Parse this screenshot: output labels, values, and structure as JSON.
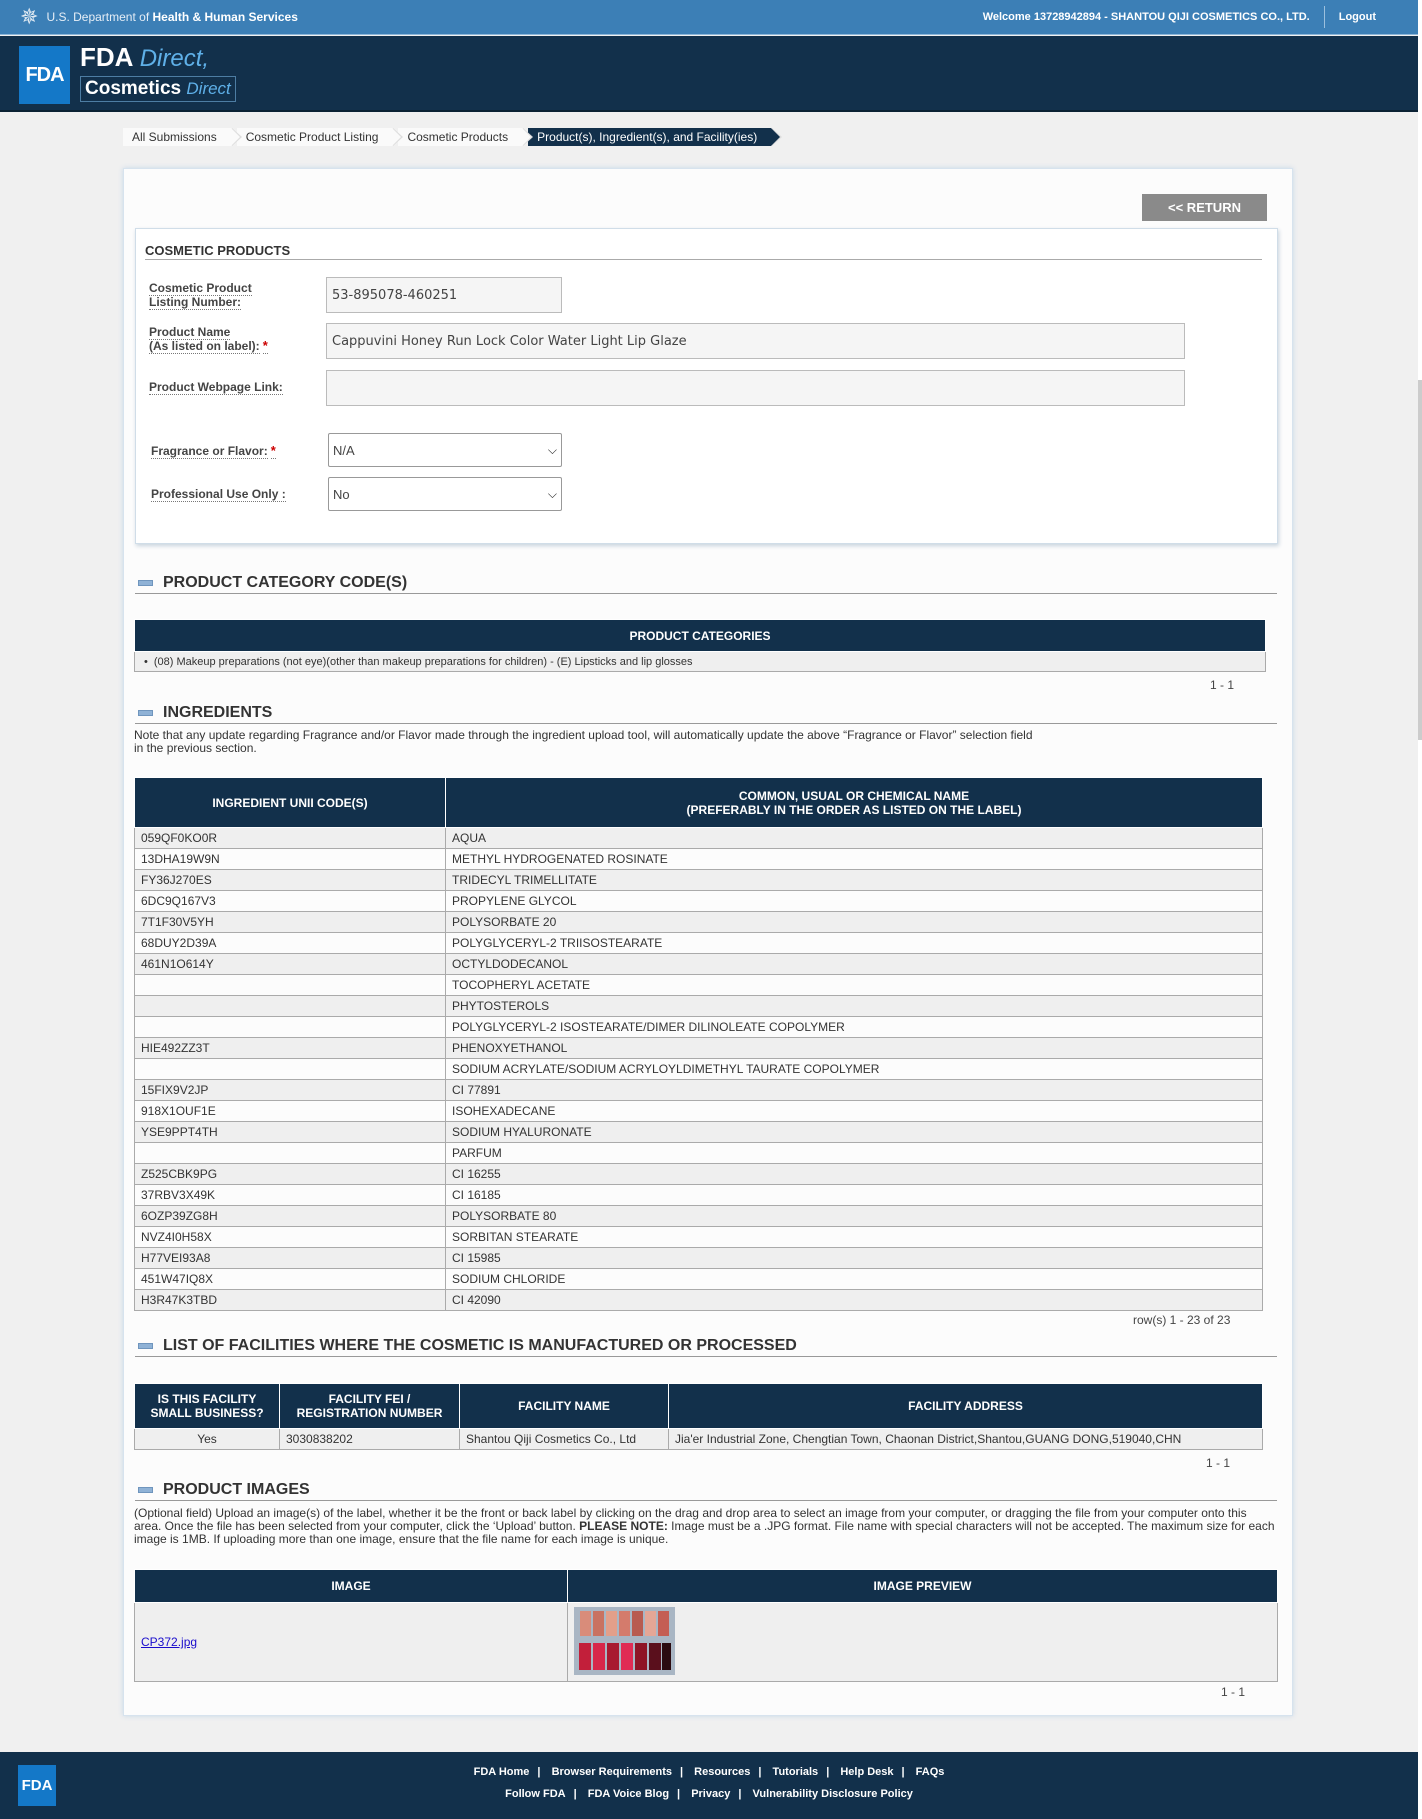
{
  "header": {
    "dept_prefix": "U.S. Department of ",
    "dept_name": "Health & Human Services",
    "welcome": "Welcome 13728942894 - SHANTOU QIJI COSMETICS CO., LTD.",
    "logout": "Logout"
  },
  "banner": {
    "logo": "FDA",
    "line1_bold": "FDA",
    "line1_italic": "Direct",
    "line2_bold": "Cosmetics",
    "line2_italic": "Direct"
  },
  "breadcrumbs": [
    "All Submissions",
    "Cosmetic Product Listing",
    "Cosmetic Products",
    "Product(s), Ingredient(s), and Facility(ies)"
  ],
  "return_button": "<< RETURN",
  "cosmetic_products": {
    "title": "COSMETIC PRODUCTS",
    "listing_label_1": "Cosmetic Product",
    "listing_label_2": "Listing Number:",
    "listing_value": "53-895078-460251",
    "name_label_1": "Product Name",
    "name_label_2": "(As listed on label):",
    "name_value": "Cappuvini Honey Run Lock Color Water Light Lip Glaze",
    "webpage_label": "Product Webpage Link:",
    "webpage_value": "",
    "fragrance_label": "Fragrance or Flavor:",
    "fragrance_value": "N/A",
    "professional_label": "Professional Use Only :",
    "professional_value": "No",
    "required_mark": "*"
  },
  "category_section": {
    "title": "PRODUCT CATEGORY CODE(S)",
    "table_header": "PRODUCT CATEGORIES",
    "items": [
      "(08) Makeup preparations (not eye)(other than makeup preparations for children) - (E) Lipsticks and lip glosses"
    ],
    "pager": "1 - 1"
  },
  "ingredients_section": {
    "title": "INGREDIENTS",
    "note_1": "Note that any update regarding Fragrance and/or Flavor made through the ingredient upload tool, will automatically update the above “Fragrance or Flavor” selection field",
    "note_2": "in the previous section.",
    "col_unii": "INGREDIENT UNII CODE(S)",
    "col_name_1": "COMMON, USUAL OR CHEMICAL NAME",
    "col_name_2": "(PREFERABLY IN THE ORDER AS LISTED ON THE LABEL)",
    "rows": [
      [
        "059QF0KO0R",
        "AQUA"
      ],
      [
        "13DHA19W9N",
        "METHYL HYDROGENATED ROSINATE"
      ],
      [
        "FY36J270ES",
        "TRIDECYL TRIMELLITATE"
      ],
      [
        "6DC9Q167V3",
        "PROPYLENE GLYCOL"
      ],
      [
        "7T1F30V5YH",
        "POLYSORBATE 20"
      ],
      [
        "68DUY2D39A",
        "POLYGLYCERYL-2 TRIISOSTEARATE"
      ],
      [
        "461N1O614Y",
        "OCTYLDODECANOL"
      ],
      [
        "",
        "TOCOPHERYL ACETATE"
      ],
      [
        "",
        "PHYTOSTEROLS"
      ],
      [
        "",
        "POLYGLYCERYL-2 ISOSTEARATE/DIMER DILINOLEATE COPOLYMER"
      ],
      [
        "HIE492ZZ3T",
        "PHENOXYETHANOL"
      ],
      [
        "",
        "SODIUM ACRYLATE/SODIUM ACRYLOYLDIMETHYL TAURATE COPOLYMER"
      ],
      [
        "15FIX9V2JP",
        "CI 77891"
      ],
      [
        "918X1OUF1E",
        "ISOHEXADECANE"
      ],
      [
        "YSE9PPT4TH",
        "SODIUM HYALURONATE"
      ],
      [
        "",
        "PARFUM"
      ],
      [
        "Z525CBK9PG",
        "CI 16255"
      ],
      [
        "37RBV3X49K",
        "CI 16185"
      ],
      [
        "6OZP39ZG8H",
        "POLYSORBATE 80"
      ],
      [
        "NVZ4I0H58X",
        "SORBITAN STEARATE"
      ],
      [
        "H77VEI93A8",
        "CI 15985"
      ],
      [
        "451W47IQ8X",
        "SODIUM CHLORIDE"
      ],
      [
        "H3R47K3TBD",
        "CI 42090"
      ]
    ],
    "pager": "row(s) 1 - 23 of 23"
  },
  "facilities_section": {
    "title": "LIST OF FACILITIES WHERE THE COSMETIC IS MANUFACTURED OR PROCESSED",
    "col_small_1": "IS THIS FACILITY",
    "col_small_2": "SMALL BUSINESS?",
    "col_fei_1": "FACILITY FEI /",
    "col_fei_2": "REGISTRATION NUMBER",
    "col_name": "FACILITY NAME",
    "col_address": "FACILITY ADDRESS",
    "rows": [
      [
        "Yes",
        "3030838202",
        "Shantou Qiji Cosmetics Co., Ltd",
        "Jia'er Industrial Zone, Chengtian Town, Chaonan District,Shantou,GUANG DONG,519040,CHN"
      ]
    ],
    "pager": "1 - 1"
  },
  "images_section": {
    "title": "PRODUCT IMAGES",
    "note_1": "(Optional field) Upload an image(s) of the label, whether it be the front or back label by clicking on the drag and drop area to select an image from your computer, or dragging the file from your computer onto this",
    "note_2a": "area. Once the file has been selected from your computer, click the ‘Upload’ button. ",
    "note_2b": "PLEASE NOTE:",
    "note_2c": " Image must be a .JPG format. File name with special characters will not be accepted. The maximum size for each",
    "note_3": "image is 1MB. If uploading more than one image, ensure that the file name for each image is unique.",
    "col_image": "IMAGE",
    "col_preview": "IMAGE PREVIEW",
    "file_name": "CP372.jpg",
    "pager": "1 - 1"
  },
  "footer": {
    "logo": "FDA",
    "row1": [
      "FDA Home",
      "Browser Requirements",
      "Resources",
      "Tutorials",
      "Help Desk",
      "FAQs"
    ],
    "row2": [
      "Follow FDA",
      "FDA Voice Blog",
      "Privacy",
      "Vulnerability Disclosure Policy"
    ],
    "separator": "|"
  },
  "colors": {
    "navy": "#12304b",
    "hhs_blue": "#3c7fb6",
    "fda_blue": "#1478c8",
    "required": "#cc0000"
  }
}
